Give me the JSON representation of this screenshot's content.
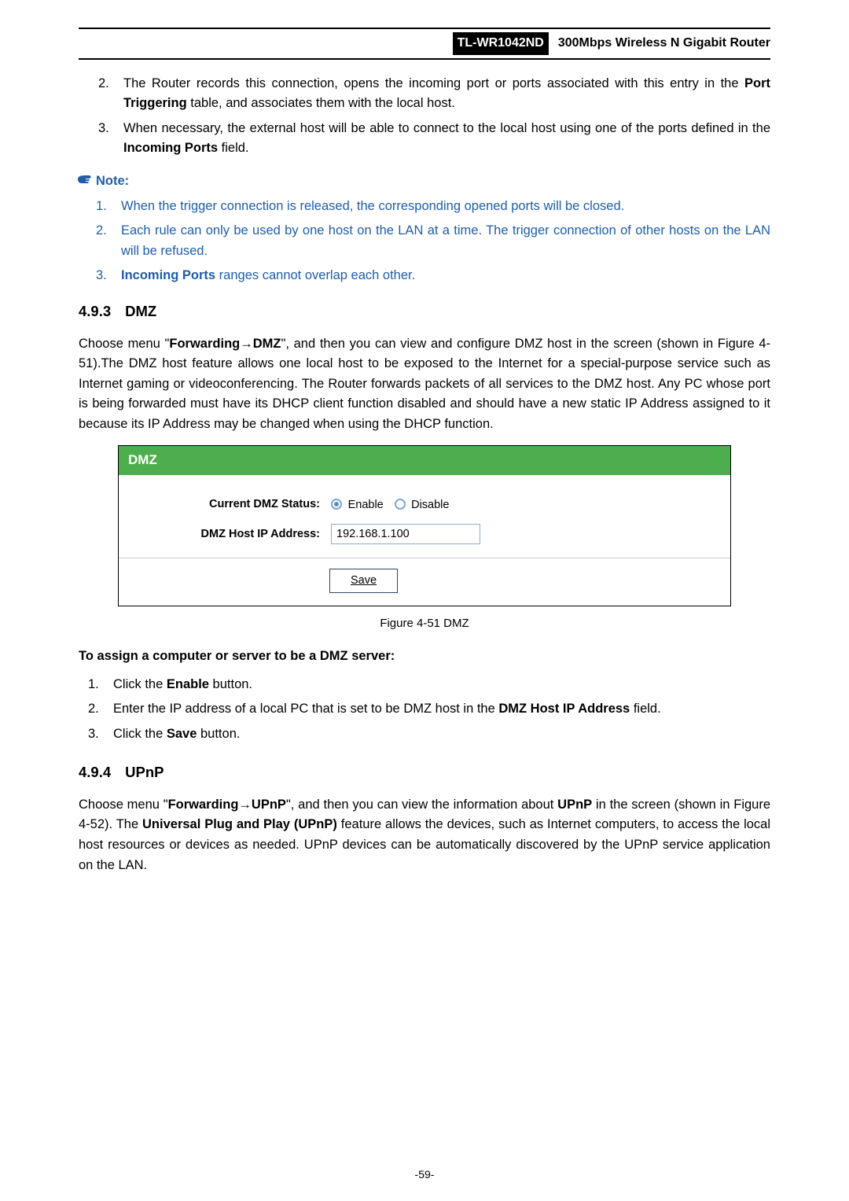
{
  "header": {
    "model": "TL-WR1042ND",
    "tagline": "300Mbps Wireless N Gigabit Router"
  },
  "list1": {
    "i2_num": "2.",
    "i2_a": "The Router records this connection, opens the incoming port or ports associated with this entry in the ",
    "i2_b": "Port Triggering",
    "i2_c": " table, and associates them with the local host.",
    "i3_num": "3.",
    "i3_a": "When necessary, the external host will be able to connect to the local host using one of the ports defined in the ",
    "i3_b": "Incoming Ports",
    "i3_c": " field."
  },
  "note": {
    "head": "Note:",
    "n1_num": "1.",
    "n1": "When the trigger connection is released, the corresponding opened ports will be closed.",
    "n2_num": "2.",
    "n2": "Each rule can only be used by one host on the LAN at a time. The trigger connection of other hosts on the LAN will be refused.",
    "n3_num": "3.",
    "n3_a": "Incoming Ports",
    "n3_b": " ranges cannot overlap each other."
  },
  "sec493": {
    "num": "4.9.3",
    "title": "DMZ",
    "p_a": "Choose menu \"",
    "p_b": "Forwarding",
    "p_arrow": "→",
    "p_c": "DMZ",
    "p_d": "\", and then you can view and configure DMZ host in the screen (shown in ",
    "p_e": "Figure 4-51",
    "p_f": ").The DMZ host feature allows one local host to be exposed to the Internet for a special-purpose service such as Internet gaming or videoconferencing. The Router forwards packets of all services to the DMZ host. Any PC whose port is being forwarded must have its DHCP client function disabled and should have a new static IP Address assigned to it because its IP Address may be changed when using the DHCP function."
  },
  "dmz": {
    "banner": "DMZ",
    "status_label": "Current DMZ Status:",
    "ip_label": "DMZ Host IP Address:",
    "enable": "Enable",
    "disable": "Disable",
    "ip_value": "192.168.1.100",
    "save": "Save"
  },
  "fig51": "Figure 4-51    DMZ",
  "assign_head": "To assign a computer or server to be a DMZ server:",
  "assign": {
    "a1_num": "1.",
    "a1_a": "Click the ",
    "a1_b": "Enable",
    "a1_c": " button.",
    "a2_num": "2.",
    "a2_a": "Enter the IP address of a local PC that is set to be DMZ host in the ",
    "a2_b": "DMZ Host IP Address",
    "a2_c": " field.",
    "a3_num": "3.",
    "a3_a": "Click the ",
    "a3_b": "Save",
    "a3_c": " button."
  },
  "sec494": {
    "num": "4.9.4",
    "title": "UPnP",
    "p_a": "Choose menu \"",
    "p_b": "Forwarding",
    "p_arrow": "→",
    "p_c": "UPnP",
    "p_d": "\", and then you can view the information about ",
    "p_e": "UPnP",
    "p_f": " in the screen (shown in ",
    "p_g": "Figure 4-52",
    "p_h": "). The ",
    "p_i": "Universal Plug and Play (UPnP)",
    "p_j": " feature allows the devices, such as Internet computers, to access the local host resources or devices as needed. UPnP devices can be automatically discovered by the UPnP service application on the LAN."
  },
  "footer": "-59-"
}
